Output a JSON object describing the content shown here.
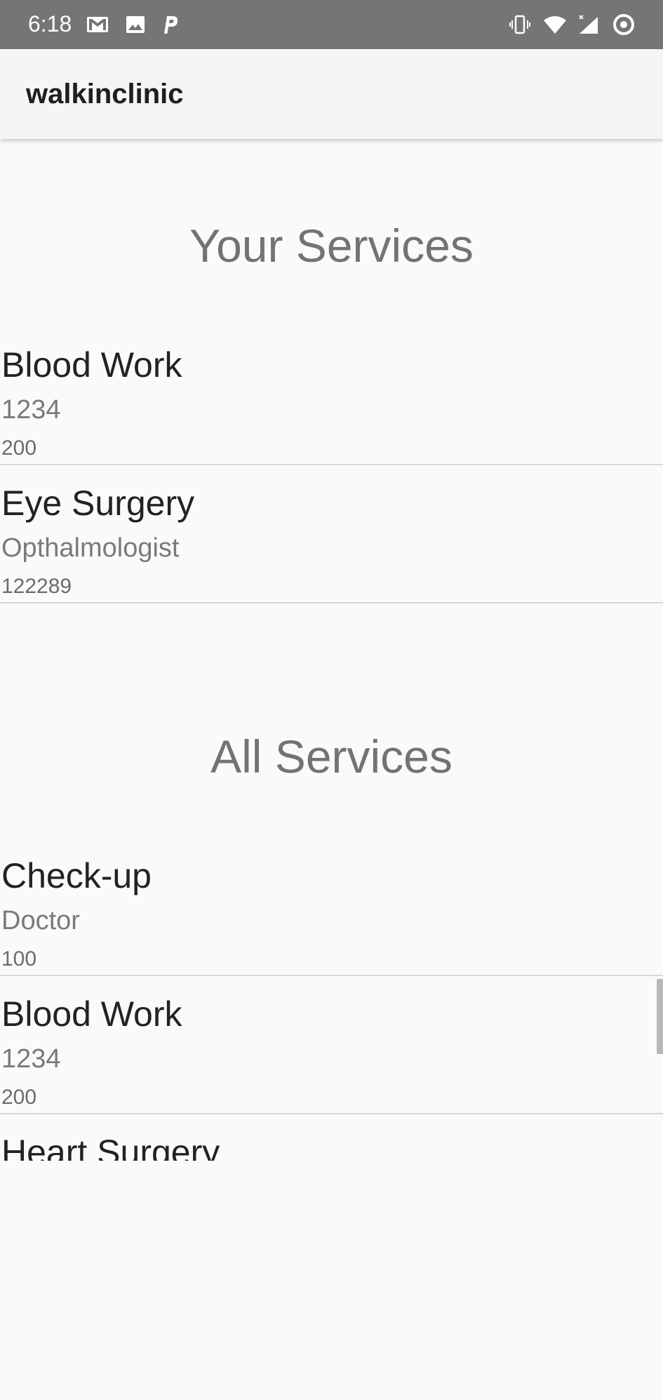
{
  "status_bar": {
    "time": "6:18",
    "left_icons": [
      "gmail-icon",
      "gallery-icon",
      "parking-icon"
    ],
    "right_icons": [
      "vibrate-icon",
      "wifi-icon",
      "signal-icon",
      "sync-icon"
    ],
    "background": "#757575"
  },
  "app_bar": {
    "title": "walkinclinic"
  },
  "your_services": {
    "title": "Your Services",
    "items": [
      {
        "name": "Blood Work",
        "role": "1234",
        "price": "200"
      },
      {
        "name": "Eye Surgery",
        "role": "Opthalmologist",
        "price": "122289"
      }
    ]
  },
  "all_services": {
    "title": "All Services",
    "items": [
      {
        "name": "Check-up",
        "role": "Doctor",
        "price": "100"
      },
      {
        "name": "Blood Work",
        "role": "1234",
        "price": "200"
      },
      {
        "name": "Heart Surgery",
        "role": "",
        "price": ""
      }
    ]
  },
  "colors": {
    "background": "#fafafa",
    "divider": "#d6d6d6",
    "section_title": "#737373"
  }
}
